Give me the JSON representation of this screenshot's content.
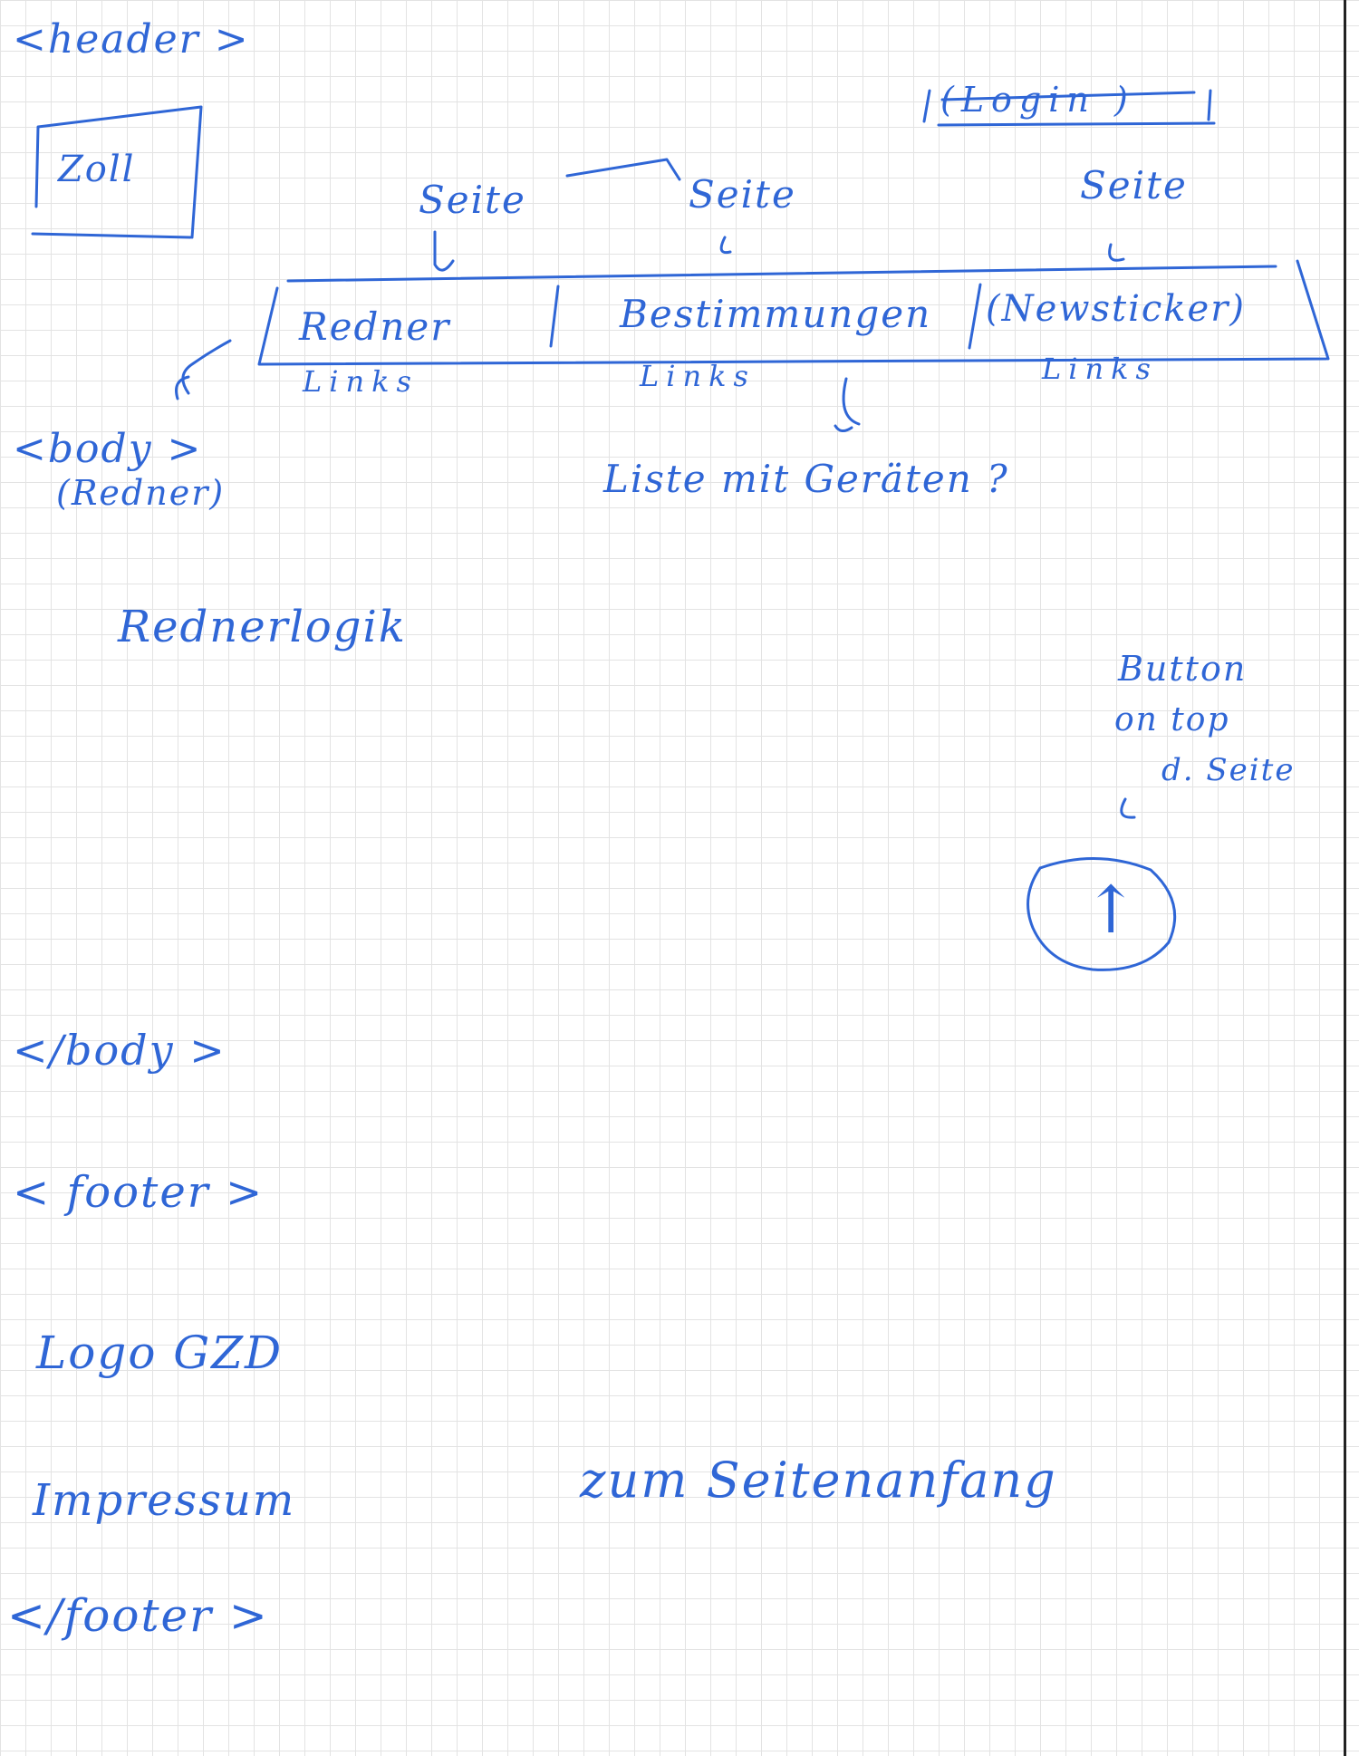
{
  "sketch": {
    "header_open": "<header >",
    "logo_box": "Zoll",
    "login_box": "(Login )",
    "page_labels": [
      "Seite",
      "Seite",
      "Seite"
    ],
    "nav": {
      "item1": "Redner",
      "item2": "Bestimmungen",
      "item3": "(Newsticker)"
    },
    "link_labels": [
      "Links",
      "Links",
      "Links"
    ],
    "list_note": "Liste mit Geräten ?",
    "body_open": "<body >",
    "body_note": "(Redner)",
    "body_content": "Rednerlogik",
    "top_button_note": [
      "Button",
      "on top",
      "d. Seite"
    ],
    "top_button_glyph": "↑",
    "body_close": "</body >",
    "footer_open": "< footer >",
    "footer_logo": "Logo GZD",
    "footer_impressum": "Impressum",
    "footer_to_top": "zum Seitenanfang",
    "footer_close": "</footer >"
  },
  "colors": {
    "ink": "#2f66d6",
    "grid": "#e3e3e3"
  }
}
